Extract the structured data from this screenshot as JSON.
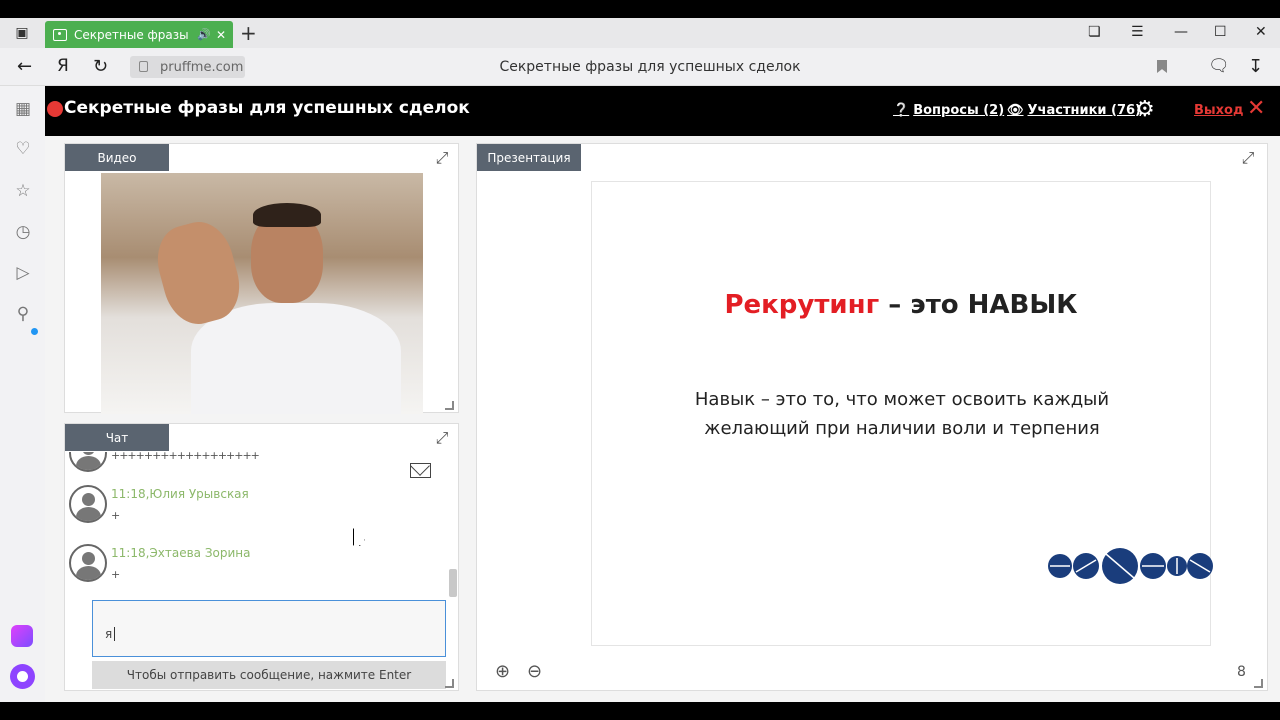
{
  "browser": {
    "tab_title": "Секретные фразы д",
    "url": "pruffme.com",
    "page_title": "Секретные фразы для успешных сделок",
    "yandex_logo": "Я"
  },
  "webinar": {
    "title": "Секретные фразы для успешных сделок",
    "questions_label": "Вопросы (2)",
    "participants_label": "Участники (76)",
    "exit_label": "Выход"
  },
  "video_panel": {
    "tab_label": "Видео"
  },
  "chat_panel": {
    "tab_label": "Чат",
    "messages": [
      {
        "time": "",
        "author": "",
        "text": "++++++++++++++++++"
      },
      {
        "time": "11:18,",
        "author": "Юлия Урывская",
        "text": "+"
      },
      {
        "time": "11:18,",
        "author": "Эхтаева Зорина",
        "text": "+"
      }
    ],
    "input_value": "я",
    "send_hint": "Чтобы отправить сообщение, нажмите Enter"
  },
  "presentation_panel": {
    "tab_label": "Презентация",
    "slide": {
      "title_highlight": "Рекрутинг",
      "title_rest": " – это НАВЫК",
      "body_line1": "Навык – это то, что может освоить каждый",
      "body_line2": "желающий при наличии воли и терпения"
    },
    "page_number": "8"
  },
  "colors": {
    "accent_green": "#4caf50",
    "record_red": "#e53935",
    "slide_red": "#e31e24",
    "tab_gray": "#5a6470",
    "logo_blue": "#1a3d7c"
  },
  "icons": [
    "sidebar-toggle-icon",
    "speaker-icon",
    "close-icon",
    "plus-icon",
    "back-icon",
    "refresh-icon",
    "lock-icon",
    "bookmark-icon",
    "download-icon",
    "question-icon",
    "eye-icon",
    "gear-icon",
    "expand-icon",
    "envelope-icon",
    "zoom-in-icon",
    "zoom-out-icon"
  ]
}
